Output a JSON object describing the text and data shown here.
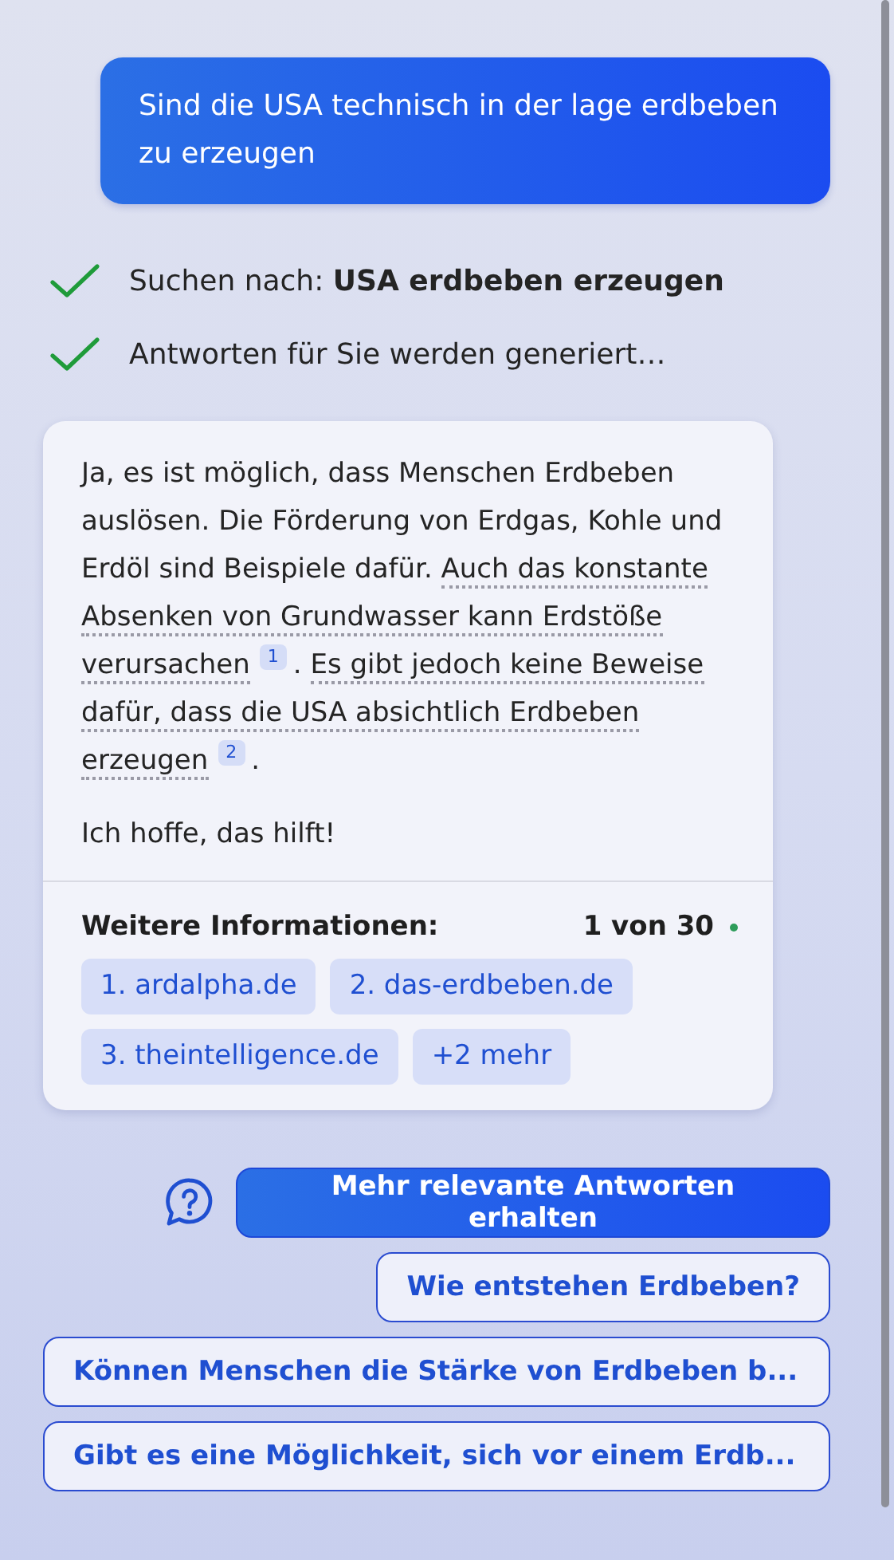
{
  "user_message": {
    "text": "Sind die USA technisch in der lage erdbeben zu erzeugen"
  },
  "steps": [
    {
      "text": "Suchen nach: **USA erdbeben erzeugen**",
      "done": true
    },
    {
      "text": "Antworten für Sie werden generiert…",
      "done": true
    }
  ],
  "answer": {
    "paragraphs": [
      {
        "segments": [
          {
            "kind": "plain",
            "text": "Ja, es ist möglich, dass Menschen Erdbeben auslösen. Die Förderung von Erdgas, Kohle und Erdöl sind Beispiele dafür. "
          },
          {
            "kind": "cited",
            "text": "Auch das konstante Absenken von Grundwasser kann Erdstöße verursachen",
            "citation": "1"
          },
          {
            "kind": "plain",
            "text": ". "
          },
          {
            "kind": "cited",
            "text": "Es gibt jedoch keine Beweise dafür, dass die USA absichtlich Erdbeben erzeugen",
            "citation": "2"
          },
          {
            "kind": "plain",
            "text": "."
          }
        ]
      },
      {
        "segments": [
          {
            "kind": "plain",
            "text": "Ich hoffe, das hilft!"
          }
        ]
      }
    ],
    "more_info": {
      "label": "Weitere Informationen:",
      "counter": "1 von 30"
    },
    "sources": [
      {
        "label": "1. ardalpha.de"
      },
      {
        "label": "2. das-erdbeben.de"
      },
      {
        "label": "3. theintelligence.de"
      },
      {
        "label": "+2 mehr"
      }
    ]
  },
  "primary_action": {
    "label": "Mehr relevante Antworten erhalten"
  },
  "suggestions": [
    {
      "label": "Wie entstehen Erdbeben?"
    },
    {
      "label": "Können Menschen die Stärke von Erdbeben b..."
    },
    {
      "label": "Gibt es eine Möglichkeit, sich vor einem Erdb..."
    }
  ]
}
